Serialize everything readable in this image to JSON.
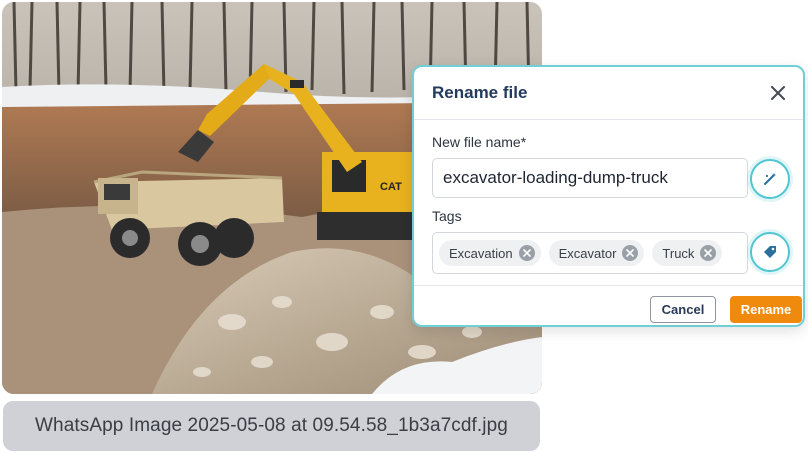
{
  "photo": {
    "alt": "Excavator loading a dump truck in a quarry"
  },
  "caption": {
    "filename": "WhatsApp Image 2025-05-08 at 09.54.58_1b3a7cdf.jpg"
  },
  "dialog": {
    "title": "Rename file",
    "name_label": "New file name*",
    "name_value": "excavator-loading-dump-truck",
    "tags_label": "Tags",
    "tags": [
      "Excavation",
      "Excavator",
      "Truck"
    ],
    "cancel_label": "Cancel",
    "rename_label": "Rename"
  },
  "colors": {
    "accent": "#4fc6d0",
    "primary_button": "#f08a0c",
    "title": "#223a5e"
  }
}
